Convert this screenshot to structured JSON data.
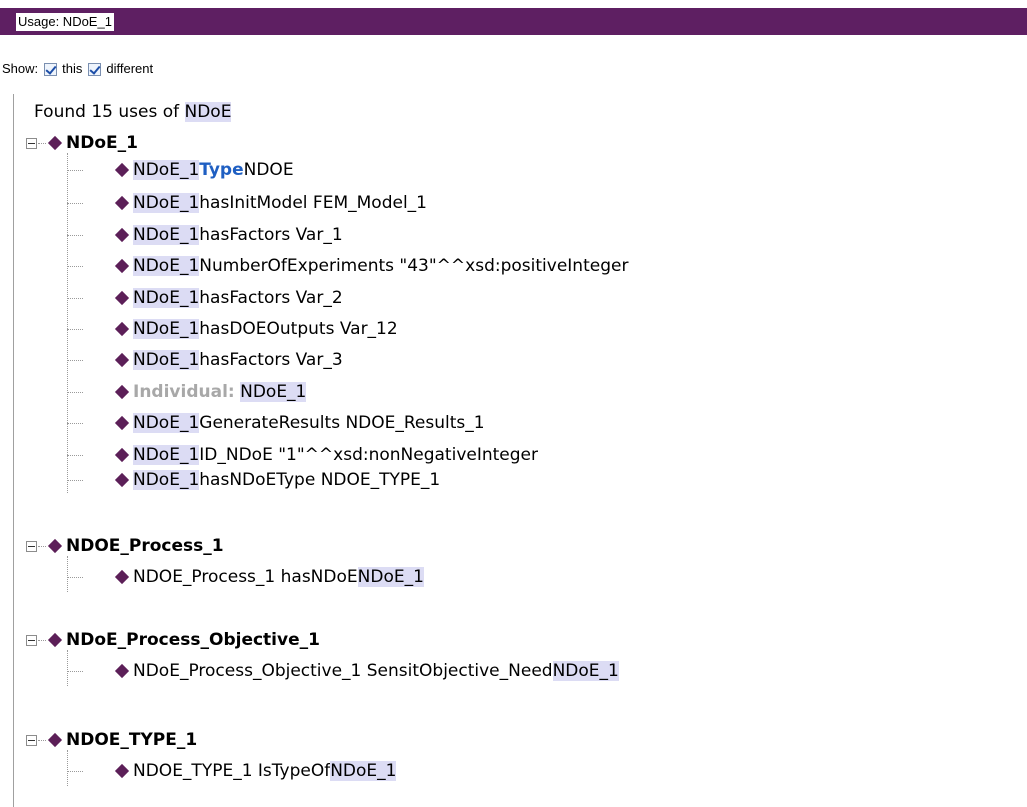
{
  "title": "Usage: NDoE_1",
  "show": {
    "label": "Show:",
    "this_label": "this",
    "different_label": "different"
  },
  "found": {
    "prefix": "Found 15 uses of ",
    "entity": "NDoE"
  },
  "groups": [
    {
      "header": "NDoE_1",
      "rows": [
        {
          "subject": "NDoE_1",
          "rest": " ",
          "kw": "Type",
          "tail": " NDOE"
        },
        {
          "subject": "NDoE_1",
          "rest": " hasInitModel FEM_Model_1"
        },
        {
          "subject": "NDoE_1",
          "rest": " hasFactors Var_1"
        },
        {
          "subject": "NDoE_1",
          "rest": " NumberOfExperiments \"43\"^^xsd:positiveInteger"
        },
        {
          "subject": "NDoE_1",
          "rest": " hasFactors Var_2"
        },
        {
          "subject": "NDoE_1",
          "rest": " hasDOEOutputs Var_12"
        },
        {
          "subject": "NDoE_1",
          "rest": " hasFactors Var_3"
        },
        {
          "ind_label": "Individual:",
          "subject2": "NDoE_1"
        },
        {
          "subject": "NDoE_1",
          "rest": " GenerateResults NDOE_Results_1"
        },
        {
          "subject": "NDoE_1",
          "rest": " ID_NDoE \"1\"^^xsd:nonNegativeInteger"
        },
        {
          "subject": "NDoE_1",
          "rest": " hasNDoEType NDOE_TYPE_1"
        }
      ]
    },
    {
      "header": "NDOE_Process_1",
      "rows": [
        {
          "lead": "NDOE_Process_1 hasNDoE ",
          "obj": "NDoE_1"
        }
      ]
    },
    {
      "header": "NDoE_Process_Objective_1",
      "rows": [
        {
          "lead": "NDoE_Process_Objective_1 SensitObjective_Need ",
          "obj": "NDoE_1"
        }
      ]
    },
    {
      "header": "NDOE_TYPE_1",
      "rows": [
        {
          "lead": "NDOE_TYPE_1 IsTypeOf ",
          "obj": "NDoE_1"
        }
      ]
    }
  ],
  "colors": {
    "titlebar": "#5e1f62",
    "diamond": "#5c1f58",
    "highlight": "#dcdcf4",
    "keyword": "#1f5fc2",
    "muted": "#a8a8a8"
  }
}
